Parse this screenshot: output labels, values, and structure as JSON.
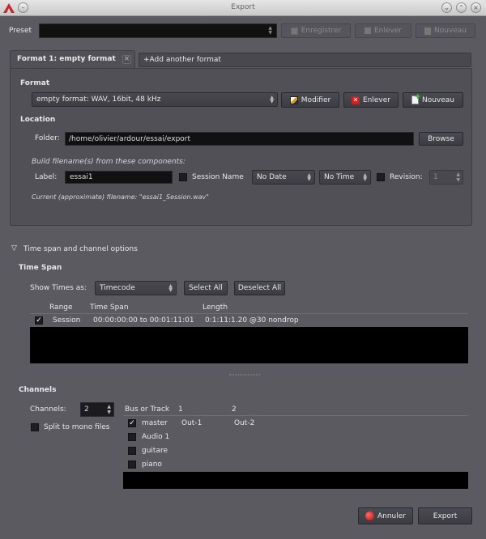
{
  "window": {
    "title": "Export"
  },
  "preset": {
    "label": "Preset",
    "value": "",
    "save_label": "Enregistrer",
    "remove_label": "Enlever",
    "new_label": "Nouveau"
  },
  "tabs": {
    "active_label": "Format 1: empty format",
    "add_label": "Add another format"
  },
  "format": {
    "heading": "Format",
    "value": "empty format: WAV, 16bit, 48 kHz",
    "modify_label": "Modifier",
    "remove_label": "Enlever",
    "new_label": "Nouveau"
  },
  "location": {
    "heading": "Location",
    "folder_label": "Folder:",
    "folder_value": "/home/olivier/ardour/essai/export",
    "browse_label": "Browse"
  },
  "filename": {
    "build_label": "Build filename(s) from these components:",
    "label_label": "Label:",
    "label_value": "essai1",
    "session_name_label": "Session Name",
    "date_value": "No Date",
    "time_value": "No Time",
    "revision_label": "Revision:",
    "revision_value": "1",
    "current_label": "Current (approximate) filename: \"essai1_Session.wav\""
  },
  "timespan_options": {
    "expander_label": "Time span and channel options",
    "heading": "Time Span",
    "show_times_label": "Show Times as:",
    "show_times_value": "Timecode",
    "select_all_label": "Select All",
    "deselect_all_label": "Deselect All",
    "columns": [
      "Range",
      "Time Span",
      "Length"
    ],
    "rows": [
      {
        "checked": true,
        "range": "Session",
        "span": "00:00:00:00 to 00:01:11:01",
        "length": "0:1:11:1.20 @30 nondrop"
      }
    ]
  },
  "channels": {
    "heading": "Channels",
    "channels_label": "Channels:",
    "channels_value": "2",
    "split_label": "Split to mono files",
    "columns": [
      "Bus or Track",
      "1",
      "2"
    ],
    "rows": [
      {
        "checked": true,
        "name": "master",
        "c1": "Out-1",
        "c2": "Out-2"
      },
      {
        "checked": false,
        "name": "Audio 1",
        "c1": "",
        "c2": ""
      },
      {
        "checked": false,
        "name": "guitare",
        "c1": "",
        "c2": ""
      },
      {
        "checked": false,
        "name": "piano",
        "c1": "",
        "c2": ""
      }
    ]
  },
  "footer": {
    "cancel_label": "Annuler",
    "export_label": "Export"
  },
  "colors": {
    "background": "#5a5a60",
    "field": "#111111",
    "accent_red": "#d02020"
  }
}
